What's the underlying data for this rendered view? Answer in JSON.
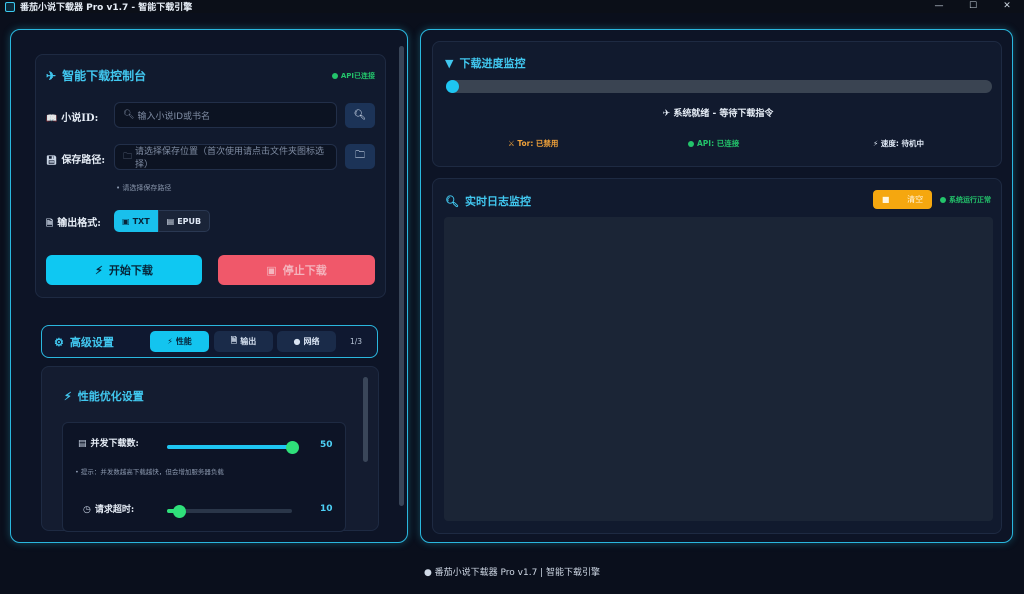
{
  "window": {
    "title": "番茄小说下载器 Pro v1.7 - 智能下载引擎",
    "controls": [
      "—",
      "☐",
      "✕"
    ]
  },
  "control_panel": {
    "title": "智能下载控制台",
    "api_status": "API已连接",
    "novel_id": {
      "label": "小说ID:",
      "placeholder": "输入小说ID或书名",
      "search_icon": "search-icon"
    },
    "save_path": {
      "label": "保存路径:",
      "placeholder": "请选择保存位置（首次使用请点击文件夹图标选择）",
      "hint": "请选择保存路径"
    },
    "format": {
      "label": "输出格式:",
      "options": [
        "TXT",
        "EPUB"
      ],
      "selected": "TXT"
    },
    "start_button": "开始下载",
    "stop_button": "停止下载"
  },
  "advanced": {
    "title": "高级设置",
    "tabs": [
      "性能",
      "输出",
      "网络"
    ],
    "active_tab": "性能",
    "page_indicator": "1/3",
    "perf_title": "性能优化设置",
    "concurrency": {
      "label": "并发下载数:",
      "value": "50",
      "level": 1.0,
      "hint": "提示：并发数越高下载越快，但会增加服务器负载"
    },
    "timeout": {
      "label": "请求超时:",
      "value": "10",
      "level": 0.1
    }
  },
  "progress": {
    "title": "下载进度监控",
    "percent": 0,
    "status": "系统就绪 - 等待下载指令",
    "tor": "Tor: 已禁用",
    "api": "API: 已连接",
    "speed": "速度: 待机中"
  },
  "log": {
    "title": "实时日志监控",
    "clear_button": "清空",
    "system_status": "系统运行正常"
  },
  "footer": "番茄小说下载器 Pro v1.7 | 智能下载引擎",
  "colors": {
    "accent": "#2ab7de",
    "primary_button": "#0fc8f2",
    "stop_button": "#f0586a",
    "success": "#23c46b",
    "warning": "#f5a70f",
    "tor_text": "#f0a23a",
    "slider_knob": "#2fe07a"
  }
}
